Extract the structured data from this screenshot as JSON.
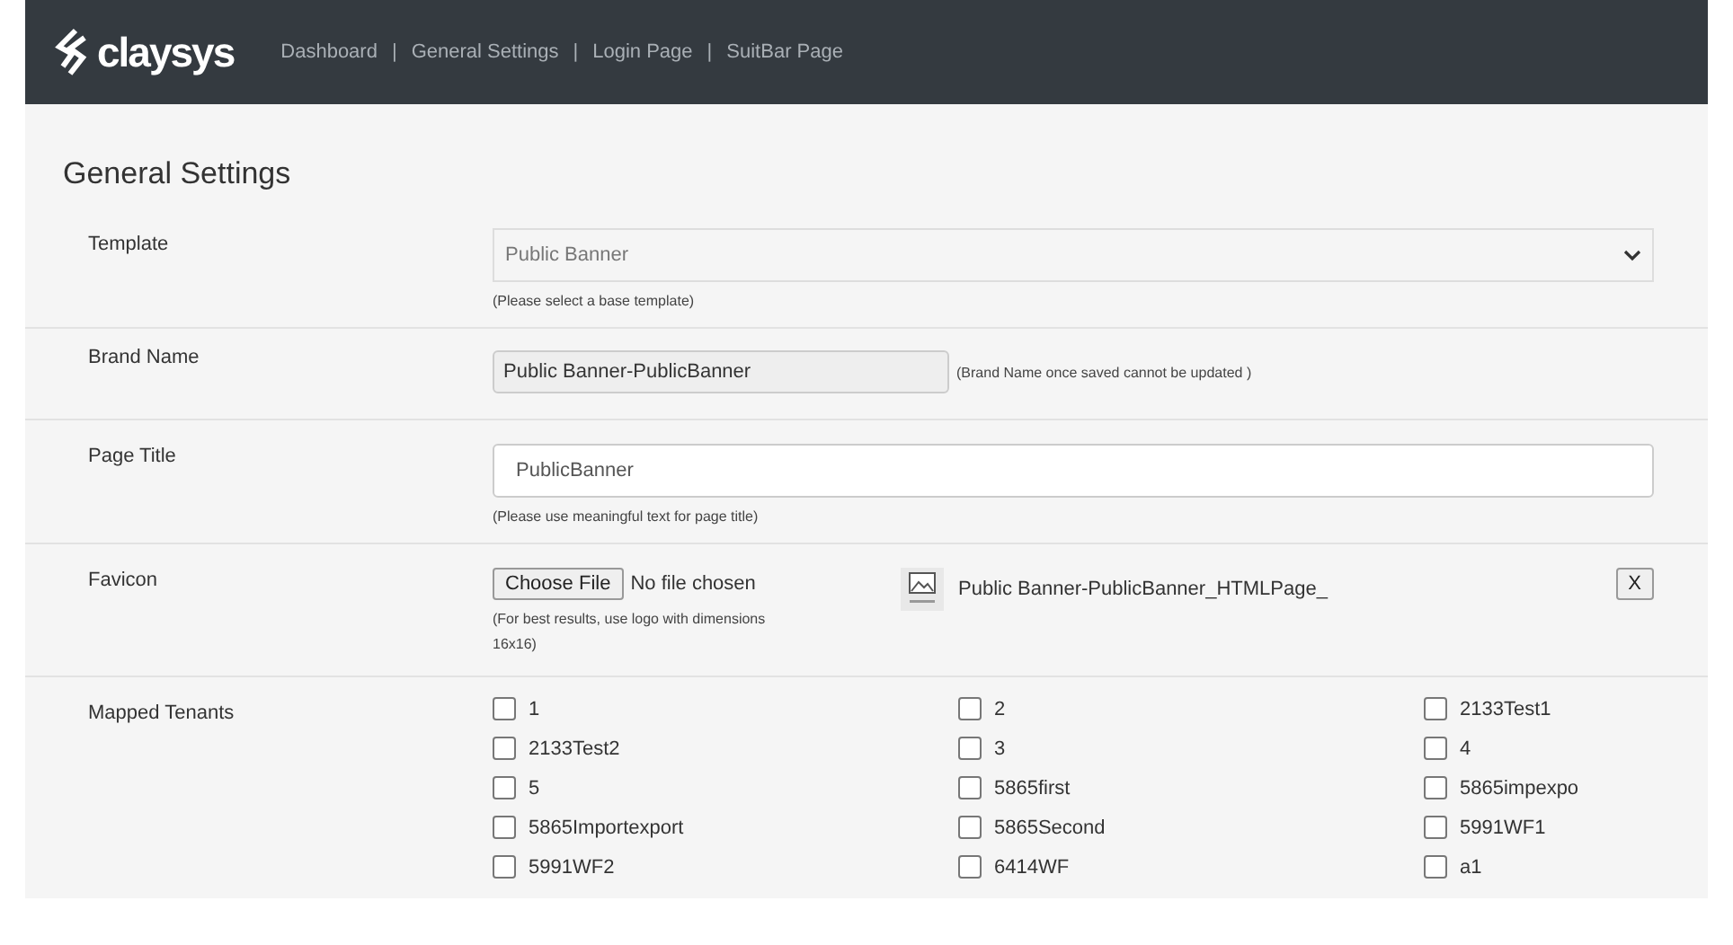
{
  "header": {
    "logo": "claysys",
    "separator": "|",
    "nav": [
      "Dashboard",
      "General Settings",
      "Login Page",
      "SuitBar Page"
    ]
  },
  "title": "General Settings",
  "template": {
    "label": "Template",
    "value": "Public Banner",
    "disabled": true,
    "hint": "(Please select a base template)"
  },
  "brand_name": {
    "label": "Brand Name",
    "value": "Public Banner-PublicBanner",
    "note": "(Brand Name once saved cannot be updated )"
  },
  "page_title": {
    "label": "Page Title",
    "value": "PublicBanner",
    "hint": "(Please use meaningful text for page title)"
  },
  "favicon": {
    "label": "Favicon",
    "button": "Choose File",
    "status": "No file chosen",
    "hint": "(For best results, use logo with dimensions 16x16)",
    "file_name": "Public Banner-PublicBanner_HTMLPage_",
    "remove": "X"
  },
  "mapped_tenants": {
    "label": "Mapped Tenants",
    "items": [
      {
        "label": "1",
        "checked": false
      },
      {
        "label": "2",
        "checked": false
      },
      {
        "label": "2133Test1",
        "checked": false
      },
      {
        "label": "2133Test2",
        "checked": false
      },
      {
        "label": "3",
        "checked": false
      },
      {
        "label": "4",
        "checked": false
      },
      {
        "label": "5",
        "checked": false
      },
      {
        "label": "5865first",
        "checked": false
      },
      {
        "label": "5865impexpo",
        "checked": false
      },
      {
        "label": "5865Importexport",
        "checked": false
      },
      {
        "label": "5865Second",
        "checked": false
      },
      {
        "label": "5991WF1",
        "checked": false
      },
      {
        "label": "5991WF2",
        "checked": false
      },
      {
        "label": "6414WF",
        "checked": false
      },
      {
        "label": "a1",
        "checked": false
      }
    ]
  }
}
